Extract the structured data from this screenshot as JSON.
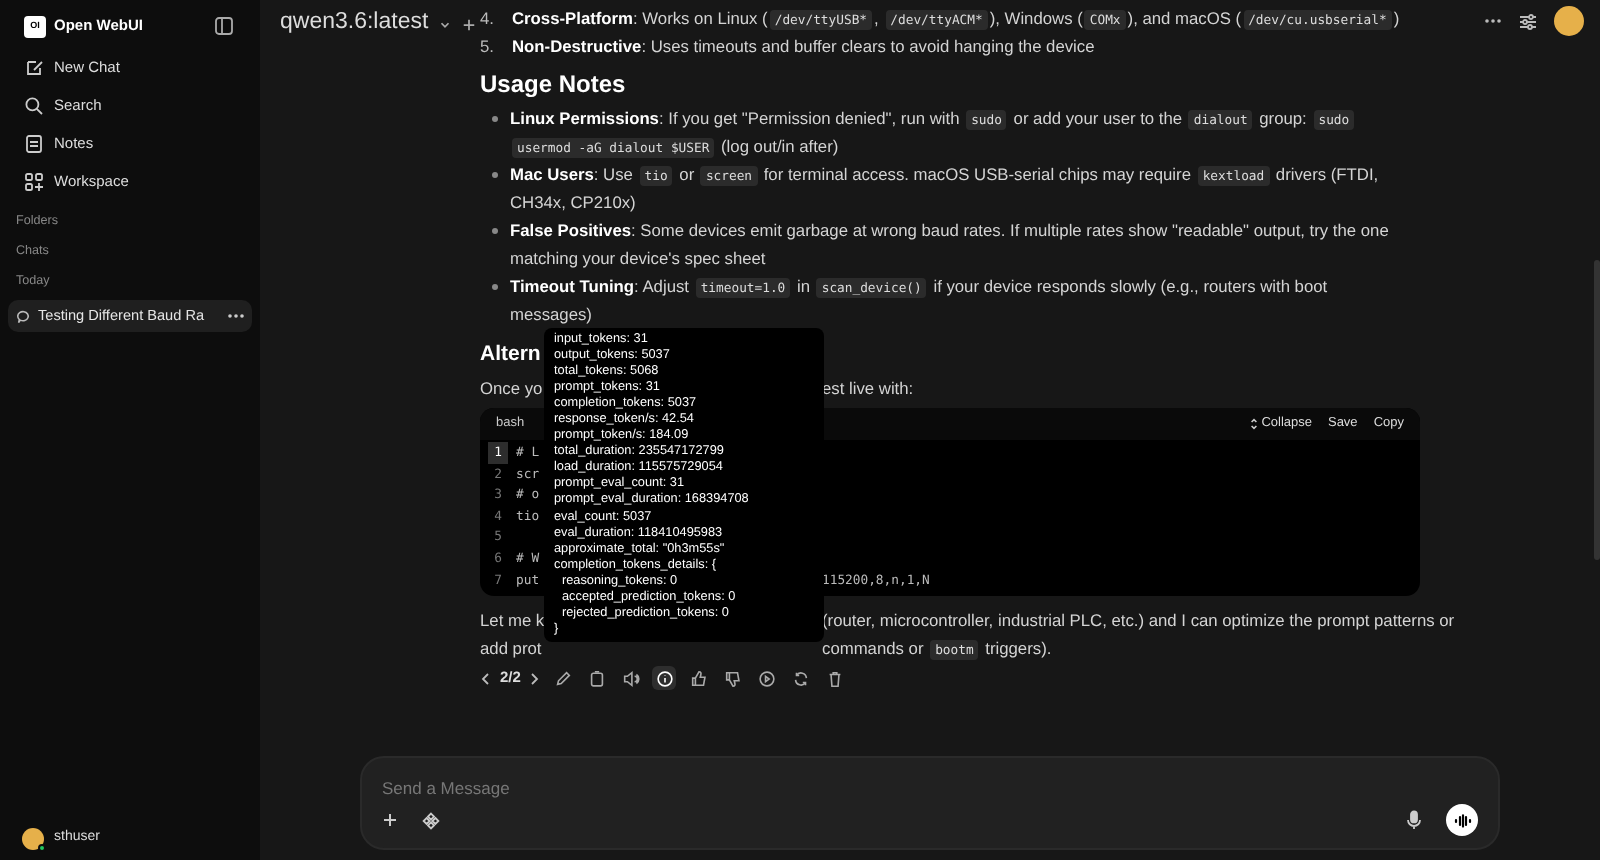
{
  "sidebar": {
    "logo_text": "OI",
    "brand": "Open WebUI",
    "nav": [
      {
        "kind": "new-chat",
        "label": "New Chat"
      },
      {
        "kind": "search",
        "label": "Search"
      },
      {
        "kind": "notes",
        "label": "Notes"
      },
      {
        "kind": "workspace",
        "label": "Workspace"
      }
    ],
    "sections": [
      "Folders",
      "Chats"
    ],
    "chat_groups": [
      {
        "label": "Today",
        "chats": [
          {
            "title": "Testing Different Baud Ra",
            "selected": true
          }
        ]
      }
    ],
    "user": {
      "name": "sthuser",
      "online": true
    }
  },
  "header": {
    "model": "qwen3.6:latest"
  },
  "message": {
    "numbered_items": [
      {
        "number": "4.",
        "parts": [
          {
            "kind": "bold",
            "text": "Cross-Platform"
          },
          {
            "kind": "text",
            "text": ": Works on Linux ("
          },
          {
            "kind": "code",
            "text": "/dev/ttyUSB*"
          },
          {
            "kind": "text",
            "text": ", "
          },
          {
            "kind": "code",
            "text": "/dev/ttyACM*"
          },
          {
            "kind": "text",
            "text": "), Windows ("
          },
          {
            "kind": "code",
            "text": "COMx"
          },
          {
            "kind": "text",
            "text": "), and macOS ("
          },
          {
            "kind": "code",
            "text": "/dev/cu.usbserial*"
          },
          {
            "kind": "text",
            "text": ")"
          }
        ]
      },
      {
        "number": "5.",
        "parts": [
          {
            "kind": "bold",
            "text": "Non-Destructive"
          },
          {
            "kind": "text",
            "text": ": Uses timeouts and buffer clears to avoid hanging the device"
          }
        ]
      }
    ],
    "section_heading": "Usage Notes",
    "bullets": [
      [
        {
          "kind": "bold",
          "text": "Linux Permissions"
        },
        {
          "kind": "text",
          "text": ": If you get \"Permission denied\", run with "
        },
        {
          "kind": "code",
          "text": "sudo"
        },
        {
          "kind": "text",
          "text": " or add your user to the "
        },
        {
          "kind": "code",
          "text": "dialout"
        },
        {
          "kind": "text",
          "text": " group: "
        },
        {
          "kind": "code",
          "text": "sudo usermod -aG dialout $USER"
        },
        {
          "kind": "text",
          "text": " (log out/in after)"
        }
      ],
      [
        {
          "kind": "bold",
          "text": "Mac Users"
        },
        {
          "kind": "text",
          "text": ": Use "
        },
        {
          "kind": "code",
          "text": "tio"
        },
        {
          "kind": "text",
          "text": " or "
        },
        {
          "kind": "code",
          "text": "screen"
        },
        {
          "kind": "text",
          "text": " for terminal access. macOS USB-serial chips may require "
        },
        {
          "kind": "code",
          "text": "kextload"
        },
        {
          "kind": "text",
          "text": " drivers (FTDI, CH34x, CP210x)"
        }
      ],
      [
        {
          "kind": "bold",
          "text": "False Positives"
        },
        {
          "kind": "text",
          "text": ": Some devices emit garbage at wrong baud rates. If multiple rates show \"readable\" output, try the one matching your device's spec sheet"
        }
      ],
      [
        {
          "kind": "bold",
          "text": "Timeout Tuning"
        },
        {
          "kind": "text",
          "text": ": Adjust "
        },
        {
          "kind": "code",
          "text": "timeout=1.0"
        },
        {
          "kind": "text",
          "text": " in "
        },
        {
          "kind": "code",
          "text": "scan_device()"
        },
        {
          "kind": "text",
          "text": " if your device responds slowly (e.g., routers with boot messages)"
        }
      ]
    ],
    "partial_heading": "Altern",
    "intro_line": {
      "left": "Once yo",
      "right": "est live with:"
    },
    "code_block": {
      "language": "bash",
      "actions": [
        {
          "kind": "collapse",
          "label": "Collapse"
        },
        {
          "kind": "save",
          "label": "Save"
        },
        {
          "kind": "copy",
          "label": "Copy"
        }
      ],
      "lines": [
        {
          "number": "1",
          "left": "# L",
          "selected": true
        },
        {
          "number": "2",
          "left": "scr",
          "selected": false
        },
        {
          "number": "3",
          "left": "# o",
          "selected": false
        },
        {
          "number": "4",
          "left": "tio",
          "selected": false
        },
        {
          "number": "5",
          "selected": false
        },
        {
          "number": "6",
          "left": "# W",
          "selected": false
        },
        {
          "number": "7",
          "left": "put",
          "right": "115200,8,n,1,N",
          "selected": false
        }
      ]
    },
    "closing_lines": [
      {
        "left": "Let me k",
        "right": [
          {
            "kind": "text",
            "text": "(router, microcontroller, industrial PLC, etc.) and I can optimize the prompt patterns or"
          }
        ]
      },
      {
        "left": "add prot",
        "right": [
          {
            "kind": "text",
            "text": "commands or "
          },
          {
            "kind": "code",
            "text": "bootm"
          },
          {
            "kind": "text",
            "text": " triggers)."
          }
        ]
      }
    ],
    "pager": "2/2",
    "actions": [
      {
        "kind": "edit",
        "hovered": false
      },
      {
        "kind": "copy",
        "hovered": false
      },
      {
        "kind": "speak",
        "hovered": false
      },
      {
        "kind": "info",
        "hovered": true
      },
      {
        "kind": "like",
        "hovered": false
      },
      {
        "kind": "dislike",
        "hovered": false
      },
      {
        "kind": "continue",
        "hovered": false
      },
      {
        "kind": "regenerate",
        "hovered": false
      },
      {
        "kind": "delete",
        "hovered": false
      }
    ]
  },
  "usage_tooltip": {
    "lines": [
      {
        "text": "input_tokens: 31"
      },
      {
        "text": "output_tokens: 5037"
      },
      {
        "text": "total_tokens: 5068"
      },
      {
        "text": "prompt_tokens: 31"
      },
      {
        "text": "completion_tokens: 5037"
      },
      {
        "text": "response_token/s: 42.54"
      },
      {
        "text": "prompt_token/s: 184.09"
      },
      {
        "text": "total_duration: 235547172799"
      },
      {
        "text": "load_duration: 115575729054"
      },
      {
        "text": "prompt_eval_count: 31"
      },
      {
        "text": "prompt_eval_duration: 168394708"
      },
      {
        "text": "eval_count: 5037"
      },
      {
        "text": "eval_duration: 118410495983"
      },
      {
        "text": "approximate_total: \"0h3m55s\""
      },
      {
        "text": "completion_tokens_details: {",
        "children": [
          {
            "text": "reasoning_tokens: 0"
          },
          {
            "text": "accepted_prediction_tokens: 0"
          },
          {
            "text": "rejected_prediction_tokens: 0"
          }
        ]
      },
      {
        "text": "}"
      }
    ]
  },
  "composer": {
    "placeholder": "Send a Message"
  }
}
